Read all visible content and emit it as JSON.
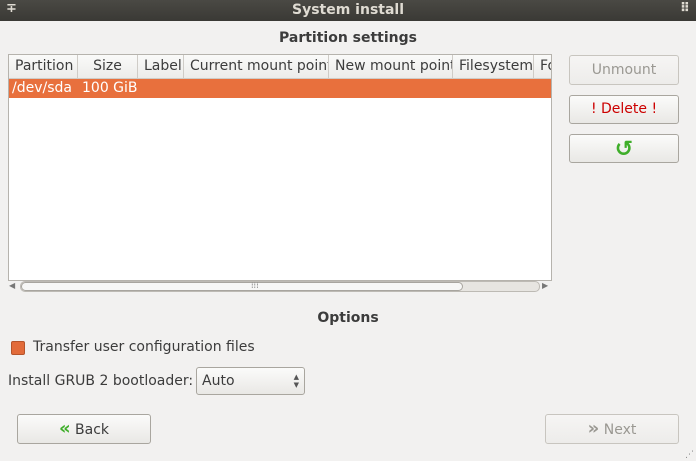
{
  "window": {
    "title": "System install",
    "menu_icon": "∓",
    "grip_icon": "⠿"
  },
  "partition": {
    "heading": "Partition settings",
    "columns": [
      "Partition",
      "Size",
      "Label",
      "Current mount point",
      "New mount point",
      "Filesystem",
      "Fo"
    ],
    "rows": [
      {
        "partition": "/dev/sda",
        "size": "100 GiB",
        "label": "",
        "current_mount": "",
        "new_mount": "",
        "filesystem": "",
        "format": ""
      }
    ],
    "scroll_grip": "⁞⁞⁞"
  },
  "side_buttons": {
    "unmount": "Unmount",
    "delete": "! Delete !",
    "refresh_icon": "↺"
  },
  "options": {
    "heading": "Options",
    "transfer_label": "Transfer user configuration files",
    "transfer_checked": false,
    "grub_label": "Install GRUB 2 bootloader:",
    "grub_value": "Auto"
  },
  "nav": {
    "back": "Back",
    "back_icon": "«",
    "next": "Next",
    "next_icon": "»"
  },
  "colors": {
    "accent": "#e8703d",
    "delete_text": "#cc0000",
    "refresh": "#3fae2a",
    "back_icon": "#3fae2a"
  }
}
